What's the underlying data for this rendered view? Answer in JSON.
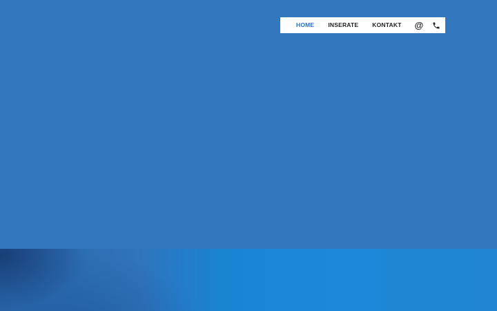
{
  "nav": {
    "items": [
      {
        "label": "HOME",
        "active": true
      },
      {
        "label": "INSERATE",
        "active": false
      },
      {
        "label": "KONTAKT",
        "active": false
      }
    ],
    "email_icon": "at-icon",
    "phone_icon": "phone-icon"
  },
  "colors": {
    "background": "#3278be",
    "nav_background": "#ffffff",
    "nav_active": "#2f6fb5",
    "nav_text": "#222222",
    "band_accent": "#1a84d4"
  }
}
